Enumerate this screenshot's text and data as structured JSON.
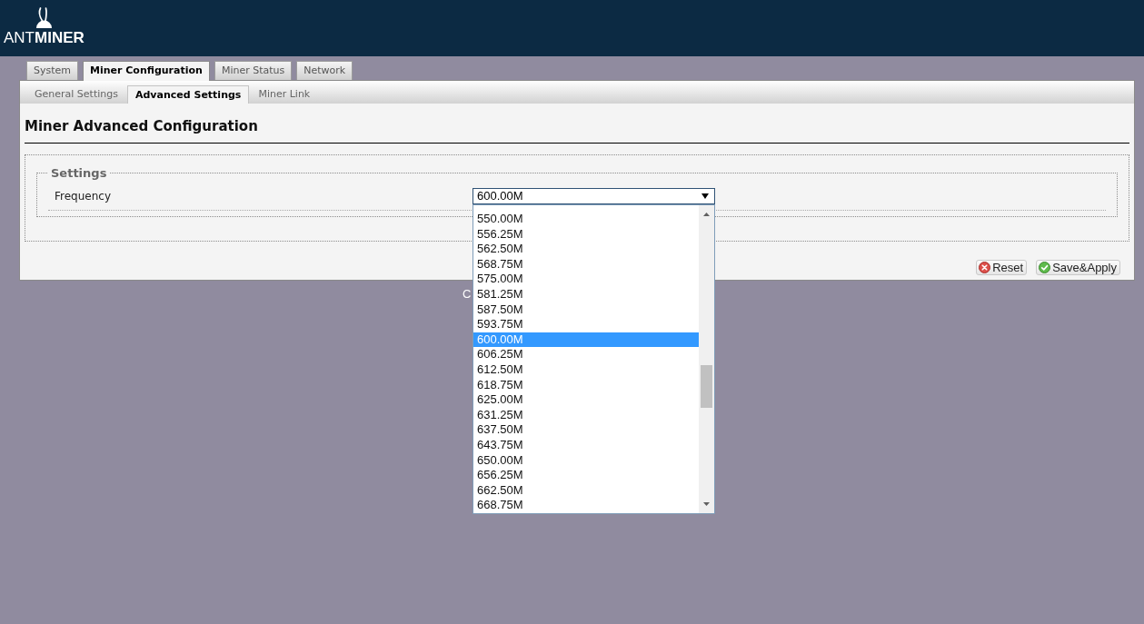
{
  "header": {
    "logo_text": "ANT**MINER**"
  },
  "tabs": [
    {
      "label": "System",
      "selected": false
    },
    {
      "label": "Miner Configuration",
      "selected": true
    },
    {
      "label": "Miner Status",
      "selected": false
    },
    {
      "label": "Network",
      "selected": false
    }
  ],
  "subtabs": [
    {
      "label": "General Settings",
      "selected": false
    },
    {
      "label": "Advanced Settings",
      "selected": true
    },
    {
      "label": "Miner Link",
      "selected": false
    }
  ],
  "page_title": "Miner Advanced Configuration",
  "settings": {
    "legend": "Settings",
    "fields": [
      {
        "label": "Frequency",
        "value": "600.00M",
        "expanded": true,
        "options": [
          {
            "label": "550.00M",
            "selected": false
          },
          {
            "label": "556.25M",
            "selected": false
          },
          {
            "label": "562.50M",
            "selected": false
          },
          {
            "label": "568.75M",
            "selected": false
          },
          {
            "label": "575.00M",
            "selected": false
          },
          {
            "label": "581.25M",
            "selected": false
          },
          {
            "label": "587.50M",
            "selected": false
          },
          {
            "label": "593.75M",
            "selected": false
          },
          {
            "label": "600.00M",
            "selected": true
          },
          {
            "label": "606.25M",
            "selected": false
          },
          {
            "label": "612.50M",
            "selected": false
          },
          {
            "label": "618.75M",
            "selected": false
          },
          {
            "label": "625.00M",
            "selected": false
          },
          {
            "label": "631.25M",
            "selected": false
          },
          {
            "label": "637.50M",
            "selected": false
          },
          {
            "label": "643.75M",
            "selected": false
          },
          {
            "label": "650.00M",
            "selected": false
          },
          {
            "label": "656.25M",
            "selected": false
          },
          {
            "label": "662.50M",
            "selected": false
          },
          {
            "label": "668.75M",
            "selected": false
          }
        ]
      }
    ]
  },
  "buttons": [
    {
      "label": "Reset",
      "kind": "reset"
    },
    {
      "label": "Save&Apply",
      "kind": "apply"
    }
  ],
  "footer": "C"
}
